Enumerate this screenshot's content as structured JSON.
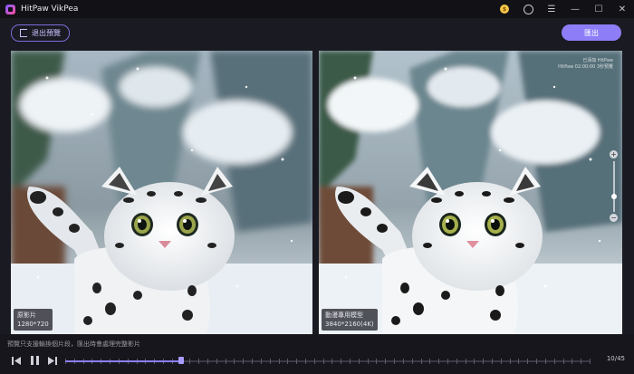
{
  "app": {
    "title": "HitPaw VikPea"
  },
  "titlebar": {
    "icons": [
      "coin-icon",
      "user-icon",
      "menu-icon",
      "minimize-icon",
      "maximize-icon",
      "close-icon"
    ]
  },
  "toolbar": {
    "exit_export_label": "退出預覽",
    "export_label": "匯出"
  },
  "preview": {
    "original_label": "原影片",
    "original_resolution": "1280*720",
    "enhanced_label": "動漫專用模型",
    "enhanced_resolution": "3840*2160(4K)",
    "watermark_line1": "已添加 HitPaw",
    "watermark_line2": "HitPaw 02:00:00 3秒預覽"
  },
  "zoom": {
    "plus": "+",
    "minus": "−",
    "level": 0.25
  },
  "footer": {
    "hint": "預覽只支援輸換個片段，匯出時會處理完整影片",
    "frame_counter": "10/45",
    "progress": 0.22
  },
  "colors": {
    "accent": "#8d7ef7",
    "background": "#1a1a22"
  }
}
